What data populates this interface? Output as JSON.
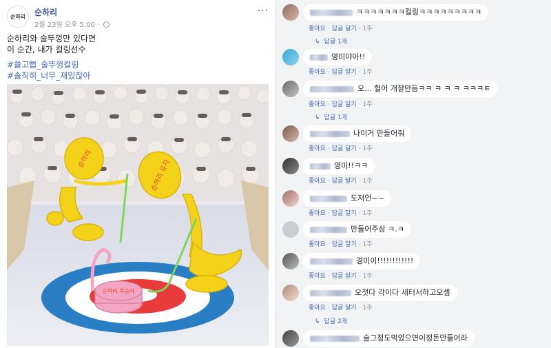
{
  "post": {
    "page_name": "순하리",
    "avatar_text": "순하리",
    "meta": "2월 23일 오후 5:00 · ",
    "text_lines": [
      "순하리와 술뚜껑만 있다면",
      "이 순간, 내가 컬링선수"
    ],
    "hashtags": [
      "#쓸고뻡_술뚜껑컬링",
      "#솔직히_너무_재밌잖아"
    ],
    "image_caps": {
      "left": "순하리",
      "mid": "순하리 유자",
      "small": "순하리 복숭아"
    }
  },
  "comments": [
    {
      "text": "ㅋㅋㅋㅋㅋㅋㅋ컬링ㅋㅋㅋㅋㅋㅋㅋㅋㅋ",
      "like": "좋아요",
      "reply": "답글 달기",
      "time": "1주",
      "replies": "답글 1개"
    },
    {
      "text": "영미야아!!",
      "like": "좋아요",
      "reply": "답글 달기",
      "time": "1주",
      "replies": ""
    },
    {
      "text": "오... 헐어 개잘만듬ㅋㅋ ㅋ ㅋ ㅋ ㅋㅋㅋㅌ",
      "like": "좋아요",
      "reply": "답글 달기",
      "time": "1주",
      "replies": "답글 1개"
    },
    {
      "text": "나이거 만들어줘",
      "like": "좋아요",
      "reply": "답글 달기",
      "time": "1주",
      "replies": ""
    },
    {
      "text": "영미!!ㅋㅋ",
      "like": "좋아요",
      "reply": "답글 달기",
      "time": "1주",
      "replies": ""
    },
    {
      "text": "도저언~~",
      "like": "좋아요",
      "reply": "답글 달기",
      "time": "1주",
      "replies": ""
    },
    {
      "text": "만들어주삼 ㅋ.ㅋ",
      "like": "좋아요",
      "reply": "답글 달기",
      "time": "1주",
      "replies": ""
    },
    {
      "text": "경미이!!!!!!!!!!!!",
      "like": "좋아요",
      "reply": "답글 달기",
      "time": "1주",
      "replies": ""
    },
    {
      "text": "오젓다 각이다 새터서하고오셈",
      "like": "좋아요",
      "reply": "답글 달기",
      "time": "1주",
      "replies": "답글 2개"
    },
    {
      "text": "술그정도먹었으면이정돈만들어라",
      "like": "",
      "reply": "",
      "time": "",
      "replies": ""
    }
  ],
  "colors": {
    "link": "#4267b2",
    "comment_bg": "#f2f3f5",
    "yellow": "#f5d21a",
    "pink": "#f2a6c4"
  }
}
